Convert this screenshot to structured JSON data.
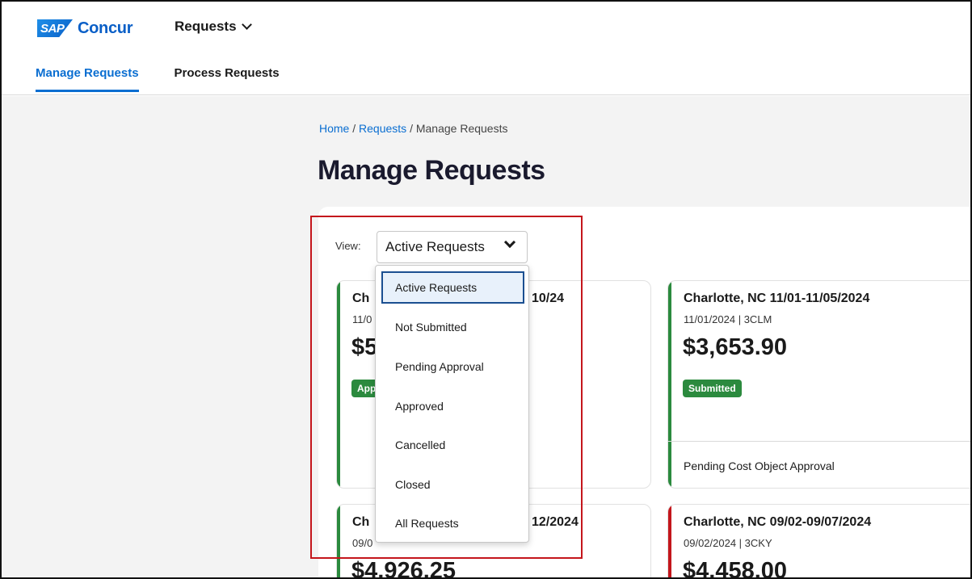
{
  "app": {
    "brand_sap": "SAP",
    "brand_name": "Concur",
    "module": "Requests"
  },
  "tabs": [
    {
      "label": "Manage Requests",
      "active": true
    },
    {
      "label": "Process Requests",
      "active": false
    }
  ],
  "breadcrumb": {
    "home": "Home",
    "sep1": " / ",
    "requests": "Requests",
    "sep2": " / ",
    "current": "Manage Requests"
  },
  "page_title": "Manage Requests",
  "view": {
    "label": "View:",
    "selected": "Active Requests",
    "options": [
      "Active Requests",
      "Not Submitted",
      "Pending Approval",
      "Approved",
      "Cancelled",
      "Closed",
      "All Requests"
    ]
  },
  "cards": [
    {
      "title_start": "Ch",
      "title_end": "10/24",
      "sub": "11/0",
      "amount": "$5",
      "status": "App",
      "status_color": "#2b8a3e",
      "accent": "#2b8a3e"
    },
    {
      "title": "Charlotte, NC 11/01-11/05/2024",
      "sub": "11/01/2024 | 3CLM",
      "amount": "$3,653.90",
      "status": "Submitted",
      "status_color": "#2b8a3e",
      "footer": "Pending Cost Object Approval",
      "accent": "#2b8a3e"
    },
    {
      "title_start": "Ch",
      "title_end": "12/2024",
      "sub": "09/0",
      "amount": "$4,926.25",
      "accent": "#2b8a3e"
    },
    {
      "title": "Charlotte, NC 09/02-09/07/2024",
      "sub": "09/02/2024 | 3CKY",
      "amount": "$4,458.00",
      "accent": "#c4161c"
    }
  ],
  "colors": {
    "accent_blue": "#0a6ed1",
    "highlight_red": "#c4161c",
    "status_green": "#2b8a3e"
  },
  "icons": {
    "module_chevron": "chevron-down-icon",
    "select_chevron": "chevron-down-icon"
  }
}
